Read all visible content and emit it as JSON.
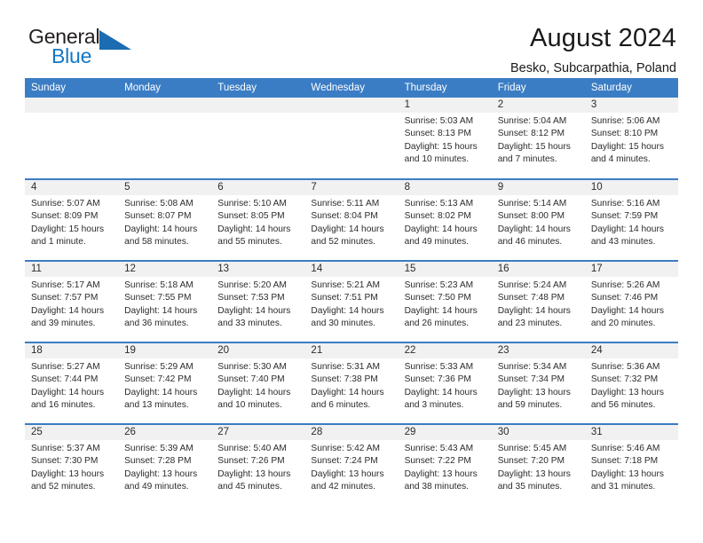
{
  "logo": {
    "word_top": "General",
    "word_bottom": "Blue",
    "triangle_color": "#1b6cb0",
    "blue_color": "#1277c4"
  },
  "header": {
    "title": "August 2024",
    "subtitle": "Besko, Subcarpathia, Poland"
  },
  "theme": {
    "header_blue": "#3b7dc4",
    "daynum_band": "#f1f1f1",
    "text": "#2b2b2b"
  },
  "weekday_headers": [
    "Sunday",
    "Monday",
    "Tuesday",
    "Wednesday",
    "Thursday",
    "Friday",
    "Saturday"
  ],
  "weeks": [
    [
      {
        "day": "",
        "empty": true,
        "sunrise": "",
        "sunset": "",
        "daylight_line1": "",
        "daylight_line2": ""
      },
      {
        "day": "",
        "empty": true,
        "sunrise": "",
        "sunset": "",
        "daylight_line1": "",
        "daylight_line2": ""
      },
      {
        "day": "",
        "empty": true,
        "sunrise": "",
        "sunset": "",
        "daylight_line1": "",
        "daylight_line2": ""
      },
      {
        "day": "",
        "empty": true,
        "sunrise": "",
        "sunset": "",
        "daylight_line1": "",
        "daylight_line2": ""
      },
      {
        "day": "1",
        "empty": false,
        "sunrise": "Sunrise: 5:03 AM",
        "sunset": "Sunset: 8:13 PM",
        "daylight_line1": "Daylight: 15 hours",
        "daylight_line2": "and 10 minutes."
      },
      {
        "day": "2",
        "empty": false,
        "sunrise": "Sunrise: 5:04 AM",
        "sunset": "Sunset: 8:12 PM",
        "daylight_line1": "Daylight: 15 hours",
        "daylight_line2": "and 7 minutes."
      },
      {
        "day": "3",
        "empty": false,
        "sunrise": "Sunrise: 5:06 AM",
        "sunset": "Sunset: 8:10 PM",
        "daylight_line1": "Daylight: 15 hours",
        "daylight_line2": "and 4 minutes."
      }
    ],
    [
      {
        "day": "4",
        "empty": false,
        "sunrise": "Sunrise: 5:07 AM",
        "sunset": "Sunset: 8:09 PM",
        "daylight_line1": "Daylight: 15 hours",
        "daylight_line2": "and 1 minute."
      },
      {
        "day": "5",
        "empty": false,
        "sunrise": "Sunrise: 5:08 AM",
        "sunset": "Sunset: 8:07 PM",
        "daylight_line1": "Daylight: 14 hours",
        "daylight_line2": "and 58 minutes."
      },
      {
        "day": "6",
        "empty": false,
        "sunrise": "Sunrise: 5:10 AM",
        "sunset": "Sunset: 8:05 PM",
        "daylight_line1": "Daylight: 14 hours",
        "daylight_line2": "and 55 minutes."
      },
      {
        "day": "7",
        "empty": false,
        "sunrise": "Sunrise: 5:11 AM",
        "sunset": "Sunset: 8:04 PM",
        "daylight_line1": "Daylight: 14 hours",
        "daylight_line2": "and 52 minutes."
      },
      {
        "day": "8",
        "empty": false,
        "sunrise": "Sunrise: 5:13 AM",
        "sunset": "Sunset: 8:02 PM",
        "daylight_line1": "Daylight: 14 hours",
        "daylight_line2": "and 49 minutes."
      },
      {
        "day": "9",
        "empty": false,
        "sunrise": "Sunrise: 5:14 AM",
        "sunset": "Sunset: 8:00 PM",
        "daylight_line1": "Daylight: 14 hours",
        "daylight_line2": "and 46 minutes."
      },
      {
        "day": "10",
        "empty": false,
        "sunrise": "Sunrise: 5:16 AM",
        "sunset": "Sunset: 7:59 PM",
        "daylight_line1": "Daylight: 14 hours",
        "daylight_line2": "and 43 minutes."
      }
    ],
    [
      {
        "day": "11",
        "empty": false,
        "sunrise": "Sunrise: 5:17 AM",
        "sunset": "Sunset: 7:57 PM",
        "daylight_line1": "Daylight: 14 hours",
        "daylight_line2": "and 39 minutes."
      },
      {
        "day": "12",
        "empty": false,
        "sunrise": "Sunrise: 5:18 AM",
        "sunset": "Sunset: 7:55 PM",
        "daylight_line1": "Daylight: 14 hours",
        "daylight_line2": "and 36 minutes."
      },
      {
        "day": "13",
        "empty": false,
        "sunrise": "Sunrise: 5:20 AM",
        "sunset": "Sunset: 7:53 PM",
        "daylight_line1": "Daylight: 14 hours",
        "daylight_line2": "and 33 minutes."
      },
      {
        "day": "14",
        "empty": false,
        "sunrise": "Sunrise: 5:21 AM",
        "sunset": "Sunset: 7:51 PM",
        "daylight_line1": "Daylight: 14 hours",
        "daylight_line2": "and 30 minutes."
      },
      {
        "day": "15",
        "empty": false,
        "sunrise": "Sunrise: 5:23 AM",
        "sunset": "Sunset: 7:50 PM",
        "daylight_line1": "Daylight: 14 hours",
        "daylight_line2": "and 26 minutes."
      },
      {
        "day": "16",
        "empty": false,
        "sunrise": "Sunrise: 5:24 AM",
        "sunset": "Sunset: 7:48 PM",
        "daylight_line1": "Daylight: 14 hours",
        "daylight_line2": "and 23 minutes."
      },
      {
        "day": "17",
        "empty": false,
        "sunrise": "Sunrise: 5:26 AM",
        "sunset": "Sunset: 7:46 PM",
        "daylight_line1": "Daylight: 14 hours",
        "daylight_line2": "and 20 minutes."
      }
    ],
    [
      {
        "day": "18",
        "empty": false,
        "sunrise": "Sunrise: 5:27 AM",
        "sunset": "Sunset: 7:44 PM",
        "daylight_line1": "Daylight: 14 hours",
        "daylight_line2": "and 16 minutes."
      },
      {
        "day": "19",
        "empty": false,
        "sunrise": "Sunrise: 5:29 AM",
        "sunset": "Sunset: 7:42 PM",
        "daylight_line1": "Daylight: 14 hours",
        "daylight_line2": "and 13 minutes."
      },
      {
        "day": "20",
        "empty": false,
        "sunrise": "Sunrise: 5:30 AM",
        "sunset": "Sunset: 7:40 PM",
        "daylight_line1": "Daylight: 14 hours",
        "daylight_line2": "and 10 minutes."
      },
      {
        "day": "21",
        "empty": false,
        "sunrise": "Sunrise: 5:31 AM",
        "sunset": "Sunset: 7:38 PM",
        "daylight_line1": "Daylight: 14 hours",
        "daylight_line2": "and 6 minutes."
      },
      {
        "day": "22",
        "empty": false,
        "sunrise": "Sunrise: 5:33 AM",
        "sunset": "Sunset: 7:36 PM",
        "daylight_line1": "Daylight: 14 hours",
        "daylight_line2": "and 3 minutes."
      },
      {
        "day": "23",
        "empty": false,
        "sunrise": "Sunrise: 5:34 AM",
        "sunset": "Sunset: 7:34 PM",
        "daylight_line1": "Daylight: 13 hours",
        "daylight_line2": "and 59 minutes."
      },
      {
        "day": "24",
        "empty": false,
        "sunrise": "Sunrise: 5:36 AM",
        "sunset": "Sunset: 7:32 PM",
        "daylight_line1": "Daylight: 13 hours",
        "daylight_line2": "and 56 minutes."
      }
    ],
    [
      {
        "day": "25",
        "empty": false,
        "sunrise": "Sunrise: 5:37 AM",
        "sunset": "Sunset: 7:30 PM",
        "daylight_line1": "Daylight: 13 hours",
        "daylight_line2": "and 52 minutes."
      },
      {
        "day": "26",
        "empty": false,
        "sunrise": "Sunrise: 5:39 AM",
        "sunset": "Sunset: 7:28 PM",
        "daylight_line1": "Daylight: 13 hours",
        "daylight_line2": "and 49 minutes."
      },
      {
        "day": "27",
        "empty": false,
        "sunrise": "Sunrise: 5:40 AM",
        "sunset": "Sunset: 7:26 PM",
        "daylight_line1": "Daylight: 13 hours",
        "daylight_line2": "and 45 minutes."
      },
      {
        "day": "28",
        "empty": false,
        "sunrise": "Sunrise: 5:42 AM",
        "sunset": "Sunset: 7:24 PM",
        "daylight_line1": "Daylight: 13 hours",
        "daylight_line2": "and 42 minutes."
      },
      {
        "day": "29",
        "empty": false,
        "sunrise": "Sunrise: 5:43 AM",
        "sunset": "Sunset: 7:22 PM",
        "daylight_line1": "Daylight: 13 hours",
        "daylight_line2": "and 38 minutes."
      },
      {
        "day": "30",
        "empty": false,
        "sunrise": "Sunrise: 5:45 AM",
        "sunset": "Sunset: 7:20 PM",
        "daylight_line1": "Daylight: 13 hours",
        "daylight_line2": "and 35 minutes."
      },
      {
        "day": "31",
        "empty": false,
        "sunrise": "Sunrise: 5:46 AM",
        "sunset": "Sunset: 7:18 PM",
        "daylight_line1": "Daylight: 13 hours",
        "daylight_line2": "and 31 minutes."
      }
    ]
  ]
}
